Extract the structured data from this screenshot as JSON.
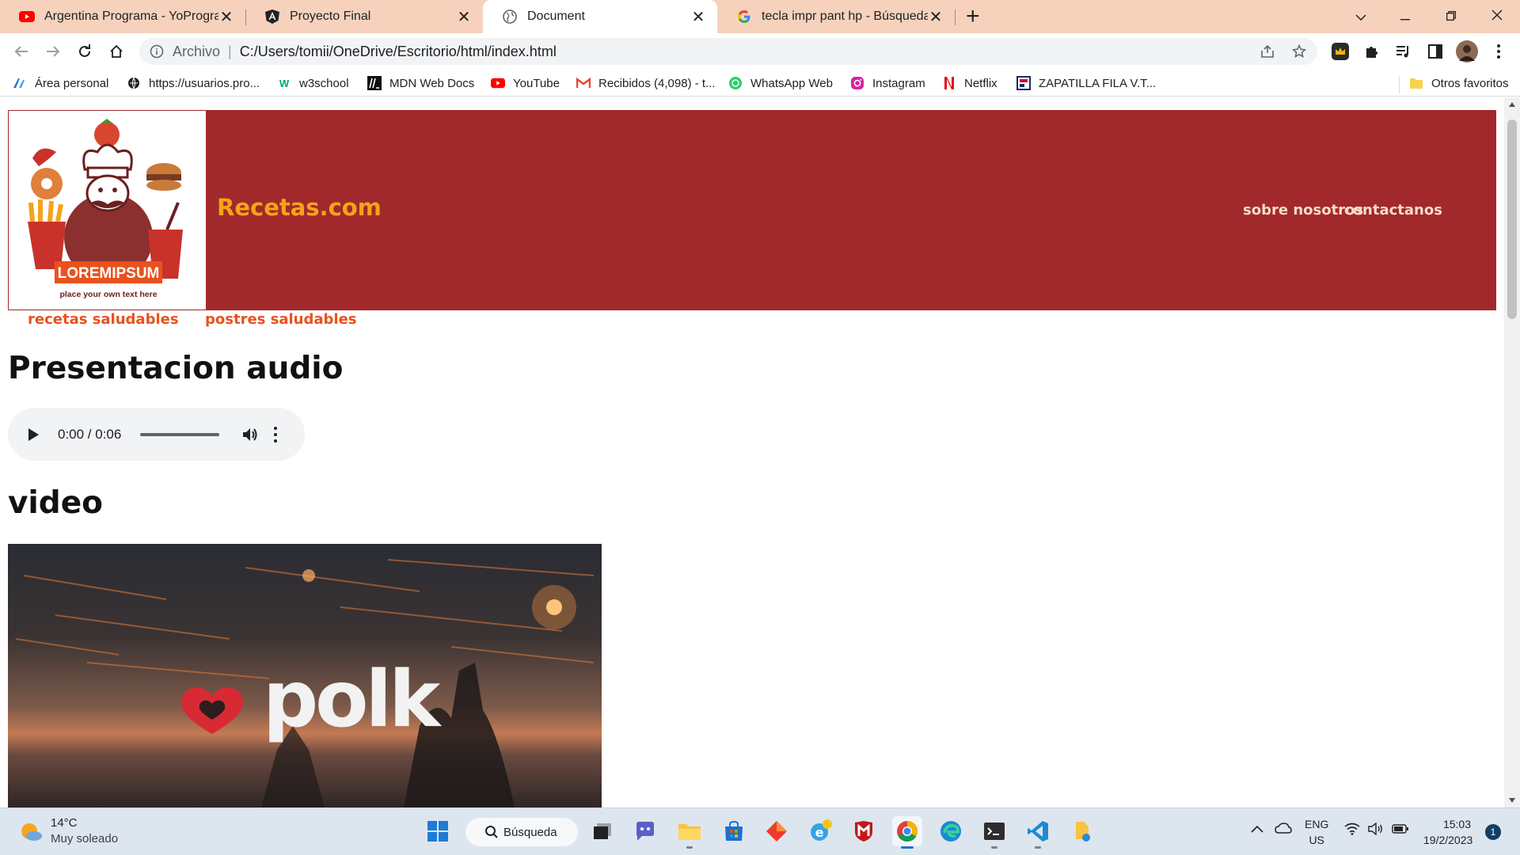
{
  "browser": {
    "tabs": [
      {
        "title": "Argentina Programa - YoProgram",
        "icon": "youtube-icon"
      },
      {
        "title": "Proyecto Final",
        "icon": "angular-icon"
      },
      {
        "title": "Document",
        "icon": "globe-icon",
        "active": true
      },
      {
        "title": "tecla impr pant hp - Búsqueda de",
        "icon": "google-icon"
      }
    ],
    "new_tab_glyph": "+",
    "omnibox": {
      "scheme_label": "Archivo",
      "url": "C:/Users/tomii/OneDrive/Escritorio/html/index.html"
    },
    "bookmarks": [
      {
        "label": "Área personal",
        "icon": "ap-icon"
      },
      {
        "label": "https://usuarios.pro...",
        "icon": "globe-icon"
      },
      {
        "label": "w3school",
        "icon": "w3-icon"
      },
      {
        "label": "MDN Web Docs",
        "icon": "mdn-icon"
      },
      {
        "label": "YouTube",
        "icon": "youtube-icon"
      },
      {
        "label": "Recibidos (4,098) - t...",
        "icon": "gmail-icon"
      },
      {
        "label": "WhatsApp Web",
        "icon": "whatsapp-icon"
      },
      {
        "label": "Instagram",
        "icon": "instagram-icon"
      },
      {
        "label": "Netflix",
        "icon": "netflix-icon"
      },
      {
        "label": "ZAPATILLA FILA V.T...",
        "icon": "fila-icon"
      }
    ],
    "other_bookmarks": "Otros favoritos"
  },
  "page": {
    "logo": {
      "brand_text": "LOREMIPSUM",
      "tagline": "place your own text here"
    },
    "site_title": "Recetas.com",
    "header_nav": [
      "sobre nosotros",
      "contactanos"
    ],
    "sub_nav": [
      "recetas saludables",
      "postres saludables"
    ],
    "audio_heading": "Presentacion audio",
    "audio": {
      "time": "0:00 / 0:06"
    },
    "video_heading": "video",
    "video": {
      "brand": "polk"
    }
  },
  "taskbar": {
    "weather": {
      "temp": "14°C",
      "desc": "Muy soleado"
    },
    "search_label": "Búsqueda",
    "lang": {
      "line1": "ENG",
      "line2": "US"
    },
    "clock": {
      "time": "15:03",
      "date": "19/2/2023"
    },
    "notifications": "1"
  },
  "colors": {
    "header_bg": "#a2292b",
    "site_title": "#f5a31a",
    "sub_nav": "#e8521e",
    "tab_strip": "#f6d2bd"
  }
}
